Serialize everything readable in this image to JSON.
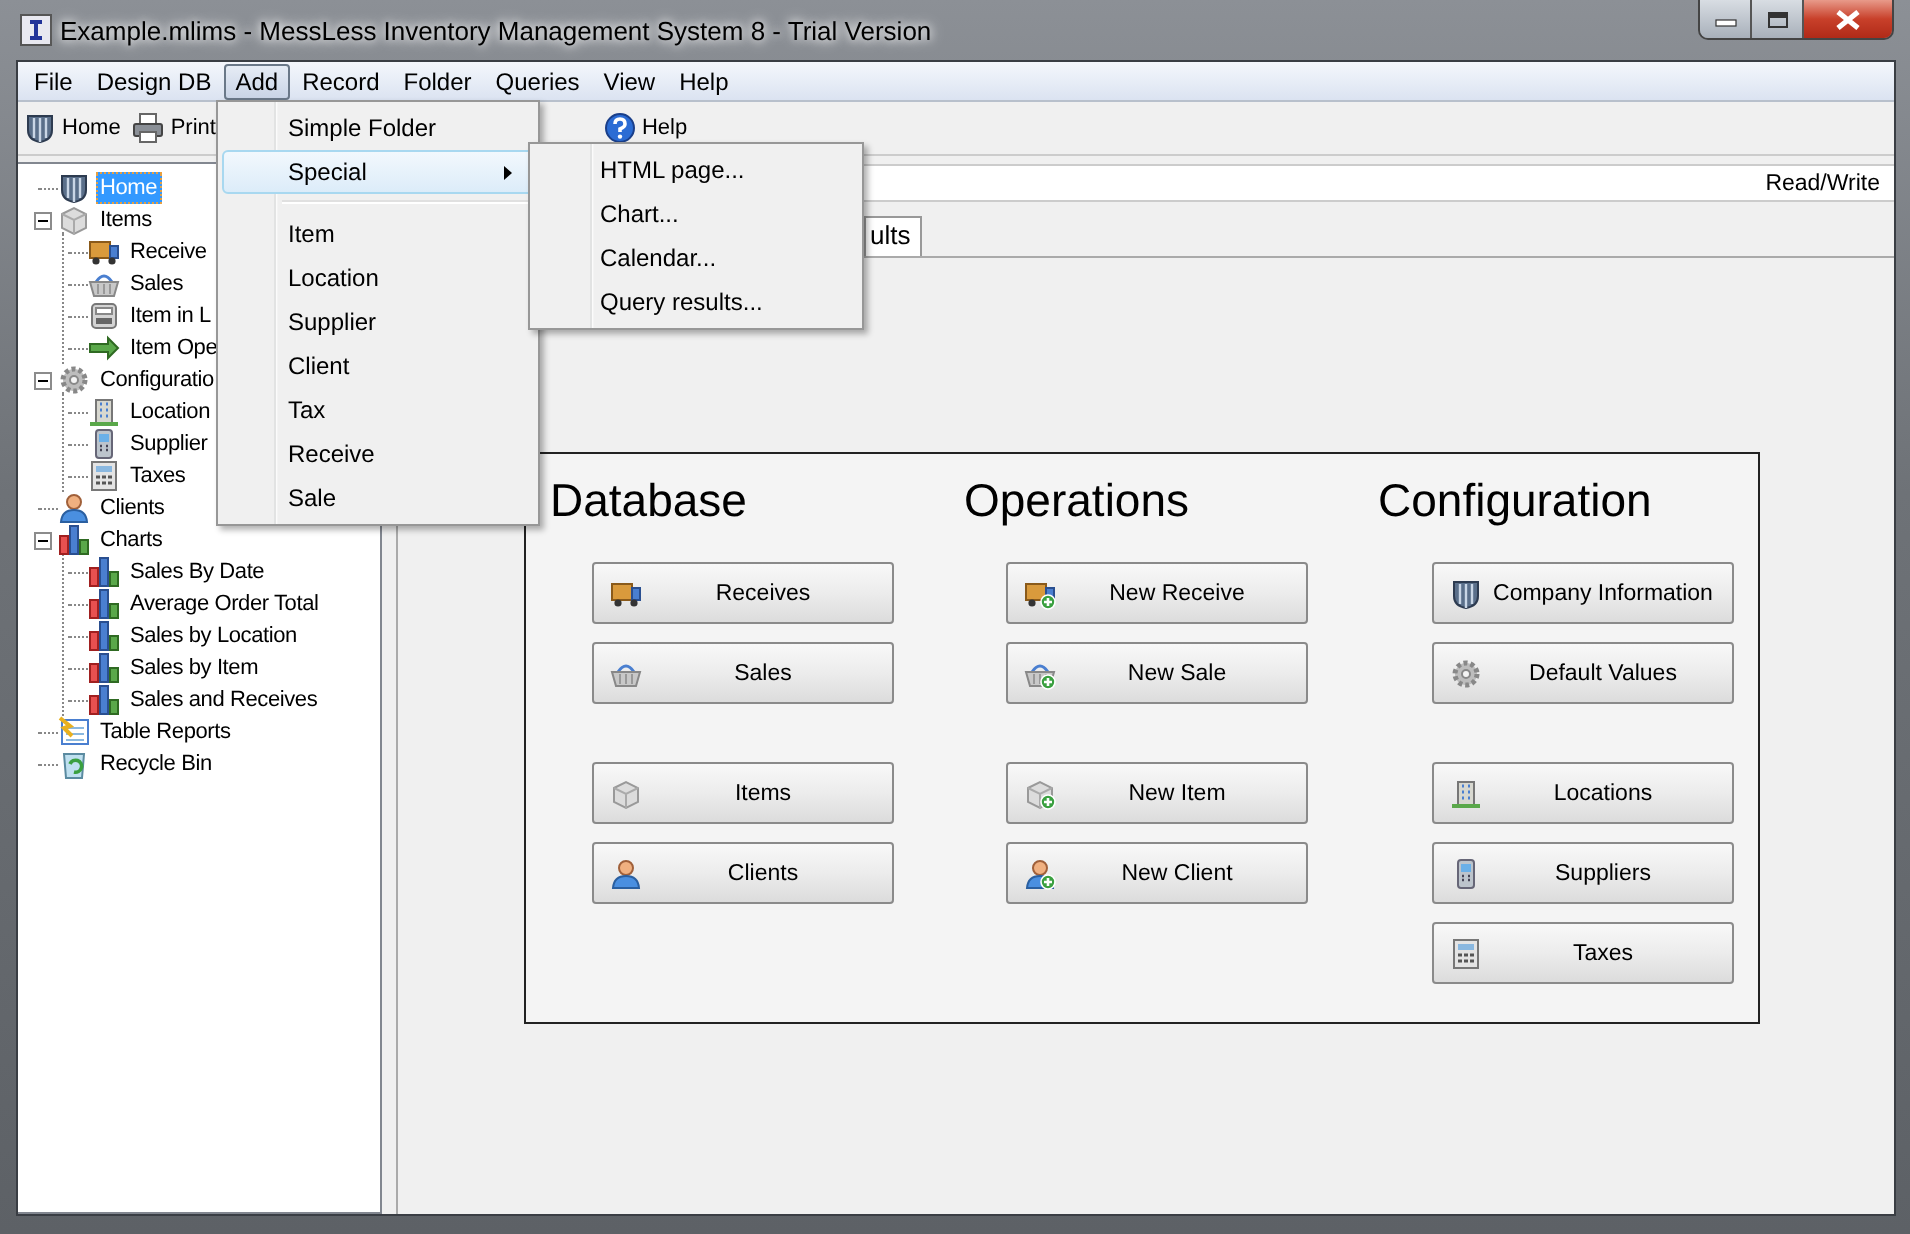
{
  "window": {
    "title": "Example.mlims - MessLess Inventory Management System 8 - Trial Version"
  },
  "menu_bar": [
    {
      "label": "File",
      "selected": false
    },
    {
      "label": "Design DB",
      "selected": false
    },
    {
      "label": "Add",
      "selected": true
    },
    {
      "label": "Record",
      "selected": false
    },
    {
      "label": "Folder",
      "selected": false
    },
    {
      "label": "Queries",
      "selected": false
    },
    {
      "label": "View",
      "selected": false
    },
    {
      "label": "Help",
      "selected": false
    }
  ],
  "toolbar": [
    {
      "label": "Home",
      "kind": "home"
    },
    {
      "label": "Print",
      "kind": "printer"
    },
    {
      "label": "Help",
      "kind": "help"
    }
  ],
  "tree": [
    {
      "label": "Home",
      "kind": "home",
      "selected": true
    },
    {
      "label": "Items",
      "kind": "items",
      "selected": false,
      "expanded": true,
      "children": [
        {
          "label": "Receive",
          "kind": "truck",
          "selected": false
        },
        {
          "label": "Sales",
          "kind": "basket",
          "selected": false
        },
        {
          "label": "Item in L",
          "kind": "machine",
          "selected": false
        },
        {
          "label": "Item Ope",
          "kind": "arrow",
          "selected": false
        }
      ]
    },
    {
      "label": "Configuratio",
      "kind": "gear",
      "selected": false,
      "expanded": true,
      "children": [
        {
          "label": "Location",
          "kind": "building",
          "selected": false
        },
        {
          "label": "Supplier",
          "kind": "phone",
          "selected": false
        },
        {
          "label": "Taxes",
          "kind": "calculator",
          "selected": false
        }
      ]
    },
    {
      "label": "Clients",
      "kind": "person",
      "selected": false
    },
    {
      "label": "Charts",
      "kind": "chart",
      "selected": false,
      "expanded": true,
      "children": [
        {
          "label": "Sales By Date",
          "kind": "chart",
          "selected": false
        },
        {
          "label": "Average Order Total",
          "kind": "chart",
          "selected": false
        },
        {
          "label": "Sales by Location",
          "kind": "chart",
          "selected": false
        },
        {
          "label": "Sales by Item",
          "kind": "chart",
          "selected": false
        },
        {
          "label": "Sales and Receives",
          "kind": "chart",
          "selected": false
        }
      ]
    },
    {
      "label": "Table Reports",
      "kind": "report",
      "selected": false
    },
    {
      "label": "Recycle Bin",
      "kind": "recycle",
      "selected": false
    }
  ],
  "address_bar": {
    "access": "Read/Write"
  },
  "tabs": [
    {
      "label": "ults",
      "selected": true
    }
  ],
  "dashboard": [
    {
      "heading": "Database",
      "groups": [
        [
          {
            "label": "Receives",
            "kind": "truck",
            "add": false
          },
          {
            "label": "Sales",
            "kind": "basket",
            "add": false
          }
        ],
        [
          {
            "label": "Items",
            "kind": "items",
            "add": false
          },
          {
            "label": "Clients",
            "kind": "person",
            "add": false
          }
        ]
      ]
    },
    {
      "heading": "Operations",
      "groups": [
        [
          {
            "label": "New Receive",
            "kind": "truck",
            "add": true
          },
          {
            "label": "New Sale",
            "kind": "basket",
            "add": true
          }
        ],
        [
          {
            "label": "New Item",
            "kind": "items",
            "add": true
          },
          {
            "label": "New Client",
            "kind": "person",
            "add": true
          }
        ]
      ]
    },
    {
      "heading": "Configuration",
      "groups": [
        [
          {
            "label": "Company Information",
            "kind": "home",
            "add": false
          },
          {
            "label": "Default Values",
            "kind": "gear",
            "add": false
          }
        ],
        [
          {
            "label": "Locations",
            "kind": "building",
            "add": false
          },
          {
            "label": "Suppliers",
            "kind": "phone",
            "add": false
          },
          {
            "label": "Taxes",
            "kind": "calculator",
            "add": false
          }
        ]
      ]
    }
  ],
  "add_menu": {
    "items": [
      {
        "kind": "item",
        "label": "Simple Folder",
        "selected": false
      },
      {
        "kind": "submenu",
        "label": "Special",
        "selected": true
      },
      {
        "kind": "separator"
      },
      {
        "kind": "item",
        "label": "Item",
        "selected": false
      },
      {
        "kind": "item",
        "label": "Location",
        "selected": false
      },
      {
        "kind": "item",
        "label": "Supplier",
        "selected": false
      },
      {
        "kind": "item",
        "label": "Client",
        "selected": false
      },
      {
        "kind": "item",
        "label": "Tax",
        "selected": false
      },
      {
        "kind": "item",
        "label": "Receive",
        "selected": false
      },
      {
        "kind": "item",
        "label": "Sale",
        "selected": false
      }
    ]
  },
  "special_submenu": {
    "items": [
      {
        "kind": "item",
        "label": "HTML page...",
        "selected": false
      },
      {
        "kind": "item",
        "label": "Chart...",
        "selected": false
      },
      {
        "kind": "item",
        "label": "Calendar...",
        "selected": false
      },
      {
        "kind": "item",
        "label": "Query results...",
        "selected": false
      }
    ]
  }
}
